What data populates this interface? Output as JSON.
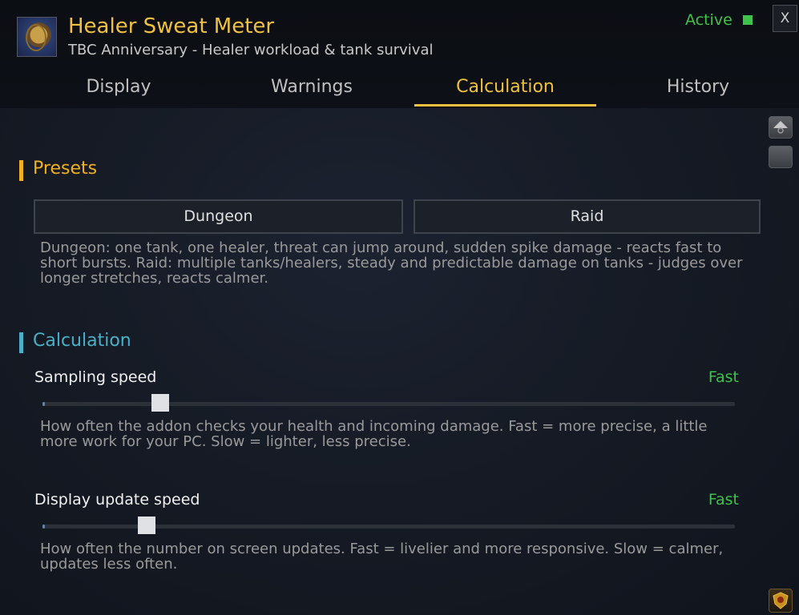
{
  "header": {
    "title": "Healer Sweat Meter",
    "subtitle": "TBC Anniversary - Healer workload & tank survival",
    "status": "Active",
    "status_color": "#3fc24a",
    "close_label": "X",
    "logo_icon": "addon-crest-icon"
  },
  "tabs": [
    {
      "label": "Display",
      "active": false
    },
    {
      "label": "Warnings",
      "active": false
    },
    {
      "label": "Calculation",
      "active": true
    },
    {
      "label": "History",
      "active": false
    }
  ],
  "sidebar_icons": [
    "scroll-up-icon",
    "scroll-thumb-icon",
    "shield-badge-icon"
  ],
  "presets": {
    "title": "Presets",
    "accent": "#f0b020",
    "buttons": [
      "Dungeon",
      "Raid"
    ],
    "description": "Dungeon: one tank, one healer, threat can jump around, sudden spike damage - reacts fast to short bursts. Raid: multiple tanks/healers, steady and predictable damage on tanks - judges over longer stretches, reacts calmer."
  },
  "calculation": {
    "title": "Calculation",
    "accent": "#4ab0c8",
    "settings": [
      {
        "label": "Sampling speed",
        "value": "Fast",
        "level": 0.17,
        "description": "How often the addon checks your health and incoming damage. Fast = more precise, a little more work for your PC. Slow = lighter, less precise."
      },
      {
        "label": "Display update speed",
        "value": "Fast",
        "level": 0.15,
        "description": "How often the number on screen updates. Fast = livelier and more responsive. Slow = calmer, updates less often."
      }
    ]
  }
}
